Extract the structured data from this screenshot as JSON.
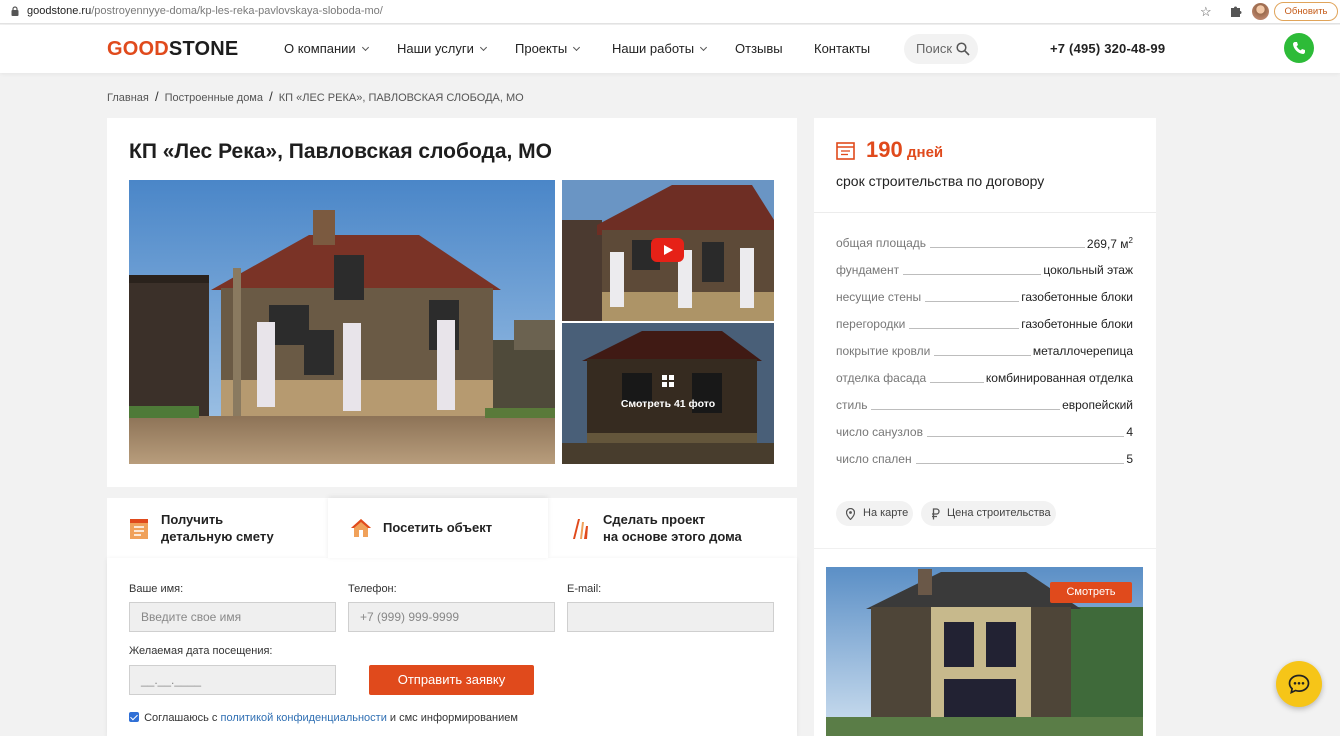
{
  "browser": {
    "url_host": "goodstone.ru",
    "url_path": "/postroyennyye-doma/kp-les-reka-pavlovskaya-sloboda-mo/",
    "update_label": "Обновить"
  },
  "header": {
    "logo_part1": "GOOD",
    "logo_part2": "STONE",
    "nav": [
      {
        "label": "О компании"
      },
      {
        "label": "Наши услуги"
      },
      {
        "label": "Проекты"
      },
      {
        "label": "Наши работы"
      },
      {
        "label": "Отзывы"
      },
      {
        "label": "Контакты"
      }
    ],
    "search_label": "Поиск",
    "phone": "+7 (495) 320-48-99"
  },
  "breadcrumb": {
    "items": [
      "Главная",
      "Построенные дома",
      "КП «ЛЕС РЕКА», ПАВЛОВСКАЯ СЛОБОДА, МО"
    ],
    "separator": "/"
  },
  "main": {
    "title": "КП «Лес Река», Павловская слобода, МО",
    "see_photos": "Смотреть 41 фото"
  },
  "tabs": [
    {
      "line1": "Получить",
      "line2": "детальную смету"
    },
    {
      "line1": "Посетить объект"
    },
    {
      "line1": "Сделать проект",
      "line2": "на основе этого дома"
    }
  ],
  "form": {
    "name_label": "Ваше имя:",
    "name_placeholder": "Введите свое имя",
    "phone_label": "Телефон:",
    "phone_placeholder": "+7 (999) 999-9999",
    "email_label": "E-mail:",
    "email_placeholder": "",
    "date_label": "Желаемая дата посещения:",
    "date_placeholder": "__.__.____",
    "submit_label": "Отправить заявку",
    "agree_prefix": "Соглашаюсь с",
    "agree_link": "политикой конфиденциальности",
    "agree_suffix": "и смс информированием"
  },
  "sidebar": {
    "days_number": "190",
    "days_unit": "дней",
    "days_caption": "срок строительства по договору",
    "specs": [
      {
        "key": "общая площадь",
        "value": "269,7 м",
        "sup": "2"
      },
      {
        "key": "фундамент",
        "value": "цокольный этаж"
      },
      {
        "key": "несущие стены",
        "value": "газобетонные блоки"
      },
      {
        "key": "перегородки",
        "value": "газобетонные блоки"
      },
      {
        "key": "покрытие кровли",
        "value": "металлочерепица"
      },
      {
        "key": "отделка фасада",
        "value": "комбинированная отделка"
      },
      {
        "key": "стиль",
        "value": "европейский"
      },
      {
        "key": "число санузлов",
        "value": "4"
      },
      {
        "key": "число спален",
        "value": "5"
      }
    ],
    "map_label": "На карте",
    "price_label": "Цена строительства",
    "promo_button": "Смотреть"
  },
  "colors": {
    "brand": "#e04a1c",
    "call_green": "#2dbb38",
    "chat_yellow": "#f6c518"
  }
}
